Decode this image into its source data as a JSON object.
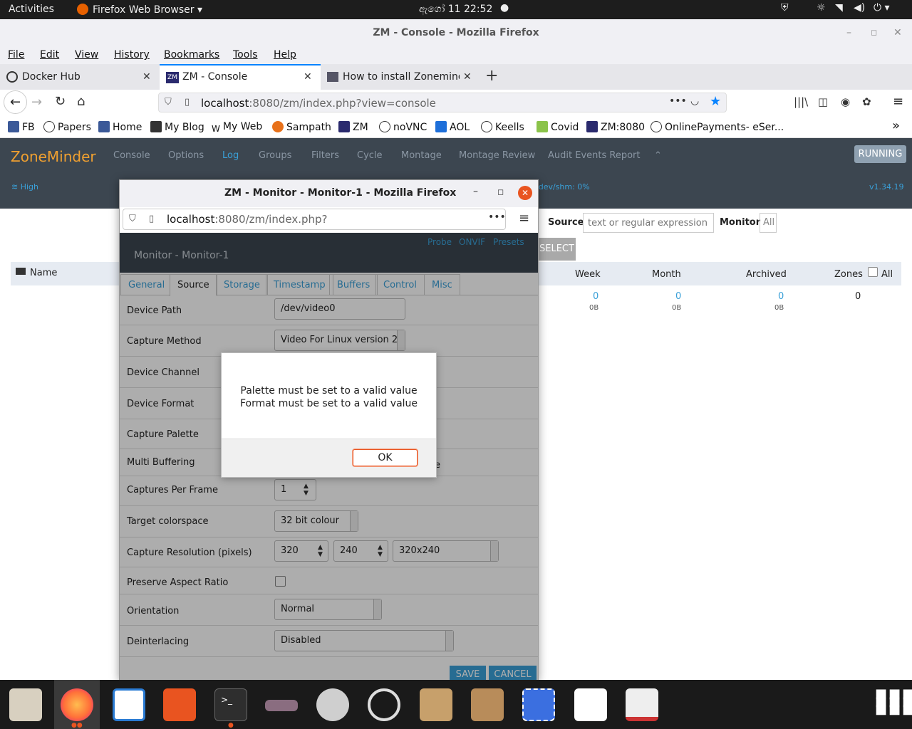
{
  "gnome": {
    "activities": "Activities",
    "app": "Firefox Web Browser",
    "clock": "ඇගෝ  11  22:52"
  },
  "firefox": {
    "window_title": "ZM - Console - Mozilla Firefox",
    "menu": [
      "File",
      "Edit",
      "View",
      "History",
      "Bookmarks",
      "Tools",
      "Help"
    ],
    "tabs": [
      {
        "label": "Docker Hub"
      },
      {
        "label": "ZM - Console"
      },
      {
        "label": "How to install Zonemind"
      }
    ],
    "url_host": "localhost",
    "url_rest": ":8080/zm/index.php?view=console",
    "bookmarks": [
      "FB",
      "Papers",
      "Home",
      "My Blog",
      "My Web",
      "Sampath",
      "ZM",
      "noVNC",
      "AOL",
      "Keells",
      "Covid",
      "ZM:8080",
      "OnlinePayments- eSer..."
    ]
  },
  "zm": {
    "brand": "ZoneMinder",
    "nav": [
      "Console",
      "Options",
      "Log",
      "Groups",
      "Filters",
      "Cycle",
      "Montage",
      "Montage Review",
      "Audit Events Report"
    ],
    "status_button": "RUNNING",
    "bandwidth": "High",
    "shm": "/dev/shm: 0%",
    "version": "v1.34.19",
    "filter": {
      "source_label": "Source",
      "source_placeholder": "text or regular expression",
      "monitor_label": "Monitor",
      "monitor_value": "All",
      "select_button": "SELECT"
    },
    "table": {
      "headers": {
        "name": "Name",
        "week": "Week",
        "month": "Month",
        "archived": "Archived",
        "zones": "Zones",
        "all": "All"
      },
      "row": {
        "week": "0",
        "week_size": "0B",
        "month": "0",
        "month_size": "0B",
        "archived": "0",
        "archived_size": "0B",
        "zones": "0"
      }
    }
  },
  "popup": {
    "title": "ZM - Monitor - Monitor-1 - Mozilla Firefox",
    "url_host": "localhost",
    "url_rest": ":8080/zm/index.php?",
    "heading": "Monitor - Monitor-1",
    "links": [
      "Probe",
      "ONVIF",
      "Presets"
    ],
    "tabs": [
      "General",
      "Source",
      "Storage",
      "Timestamp",
      "Buffers",
      "Control",
      "Misc"
    ],
    "fields": {
      "device_path": {
        "label": "Device Path",
        "value": "/dev/video0"
      },
      "capture_method": {
        "label": "Capture Method",
        "value": "Video For Linux version 2"
      },
      "device_channel": {
        "label": "Device Channel"
      },
      "device_format": {
        "label": "Device Format"
      },
      "capture_palette": {
        "label": "Capture Palette"
      },
      "multi_buffering": {
        "label": "Multi Buffering",
        "value_fragment": "e"
      },
      "captures_per_frame": {
        "label": "Captures Per Frame",
        "value": "1"
      },
      "target_colorspace": {
        "label": "Target colorspace",
        "value": "32 bit colour"
      },
      "capture_resolution": {
        "label": "Capture Resolution (pixels)",
        "width": "320",
        "height": "240",
        "preset": "320x240"
      },
      "preserve_aspect": {
        "label": "Preserve Aspect Ratio"
      },
      "orientation": {
        "label": "Orientation",
        "value": "Normal"
      },
      "deinterlacing": {
        "label": "Deinterlacing",
        "value": "Disabled"
      }
    },
    "save": "SAVE",
    "cancel": "CANCEL"
  },
  "dialog": {
    "line1": "Palette must be set to a valid value",
    "line2": "Format must be set to a valid value",
    "ok": "OK"
  }
}
